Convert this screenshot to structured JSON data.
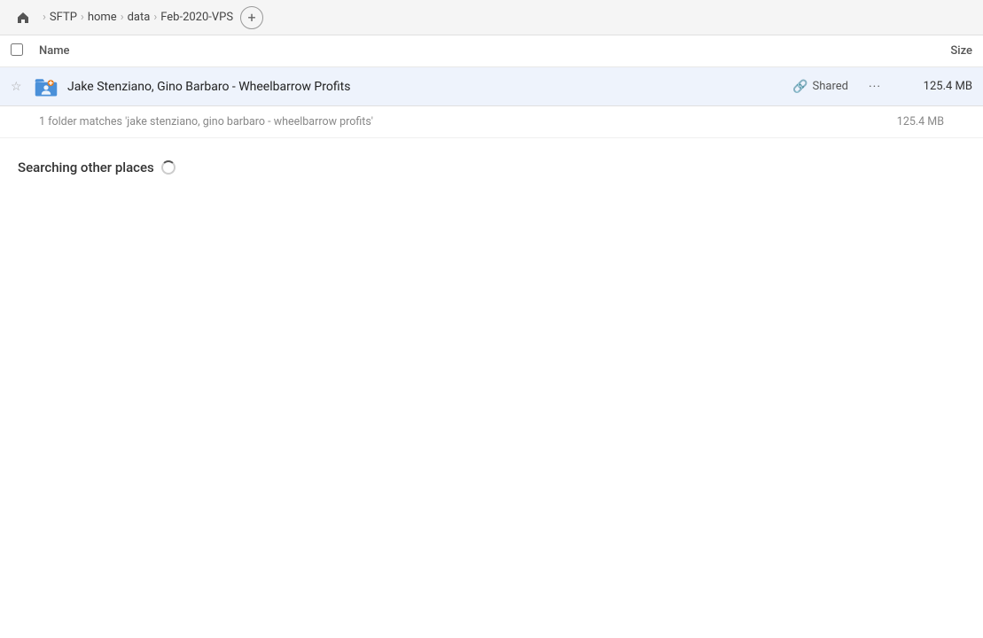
{
  "topbar": {
    "home_icon": "⌂",
    "breadcrumbs": [
      {
        "label": "SFTP",
        "id": "sftp"
      },
      {
        "label": "home",
        "id": "home"
      },
      {
        "label": "data",
        "id": "data"
      },
      {
        "label": "Feb-2020-VPS",
        "id": "feb2020vps"
      }
    ],
    "add_button_label": "+"
  },
  "columns": {
    "name_label": "Name",
    "size_label": "Size"
  },
  "file_row": {
    "star_icon": "☆",
    "folder_icon": "folder-shared",
    "name": "Jake Stenziano, Gino Barbaro - Wheelbarrow Profits",
    "shared_label": "Shared",
    "more_icon": "•••",
    "size": "125.4 MB"
  },
  "match_info": {
    "text": "1 folder matches 'jake stenziano, gino barbaro - wheelbarrow profits'",
    "size": "125.4 MB"
  },
  "searching": {
    "label": "Searching other places"
  }
}
